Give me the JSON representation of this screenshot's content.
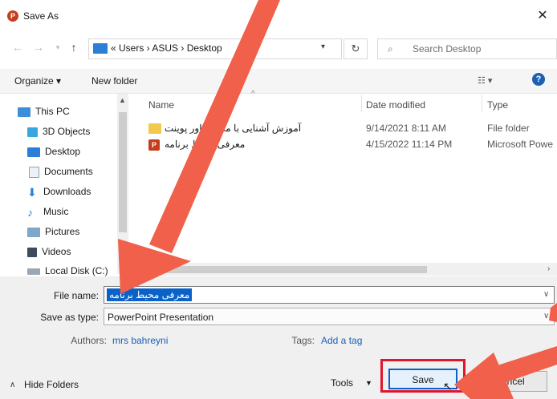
{
  "window": {
    "title": "Save As",
    "app_icon_letter": "P"
  },
  "address": {
    "crumbs": "«  Users  ›  ASUS  ›  Desktop",
    "search_placeholder": "Search Desktop"
  },
  "toolbar": {
    "organize": "Organize ▾",
    "new_folder": "New folder"
  },
  "nav": {
    "items": [
      {
        "label": "This PC",
        "icon": "computer-icon"
      },
      {
        "label": "3D Objects",
        "icon": "cube-icon"
      },
      {
        "label": "Desktop",
        "icon": "desktop-icon"
      },
      {
        "label": "Documents",
        "icon": "document-icon"
      },
      {
        "label": "Downloads",
        "icon": "download-icon"
      },
      {
        "label": "Music",
        "icon": "music-icon"
      },
      {
        "label": "Pictures",
        "icon": "pictures-icon"
      },
      {
        "label": "Videos",
        "icon": "video-icon"
      },
      {
        "label": "Local Disk (C:)",
        "icon": "drive-icon"
      }
    ]
  },
  "files": {
    "columns": {
      "name": "Name",
      "date": "Date modified",
      "type": "Type"
    },
    "rows": [
      {
        "name": "آموزش آشنایی با محیط پاور پوینت",
        "date": "9/14/2021 8:11 AM",
        "type": "File folder",
        "icon": "folder-icon"
      },
      {
        "name": "معرفی محیط برنامه",
        "date": "4/15/2022 11:14 PM",
        "type": "Microsoft Powe",
        "icon": "powerpoint-icon"
      }
    ]
  },
  "form": {
    "file_name_label": "File name:",
    "file_name_value": "معرفی محیط برنامه",
    "save_type_label": "Save as type:",
    "save_type_value": "PowerPoint Presentation",
    "authors_label": "Authors:",
    "authors_value": "mrs bahreyni",
    "tags_label": "Tags:",
    "tags_value": "Add a tag"
  },
  "footer": {
    "hide_folders": "Hide Folders",
    "tools": "Tools",
    "save": "Save",
    "cancel": "Cancel"
  },
  "colors": {
    "accent": "#0a62c9",
    "highlight": "#e0152f",
    "arrow": "#f0604a"
  }
}
